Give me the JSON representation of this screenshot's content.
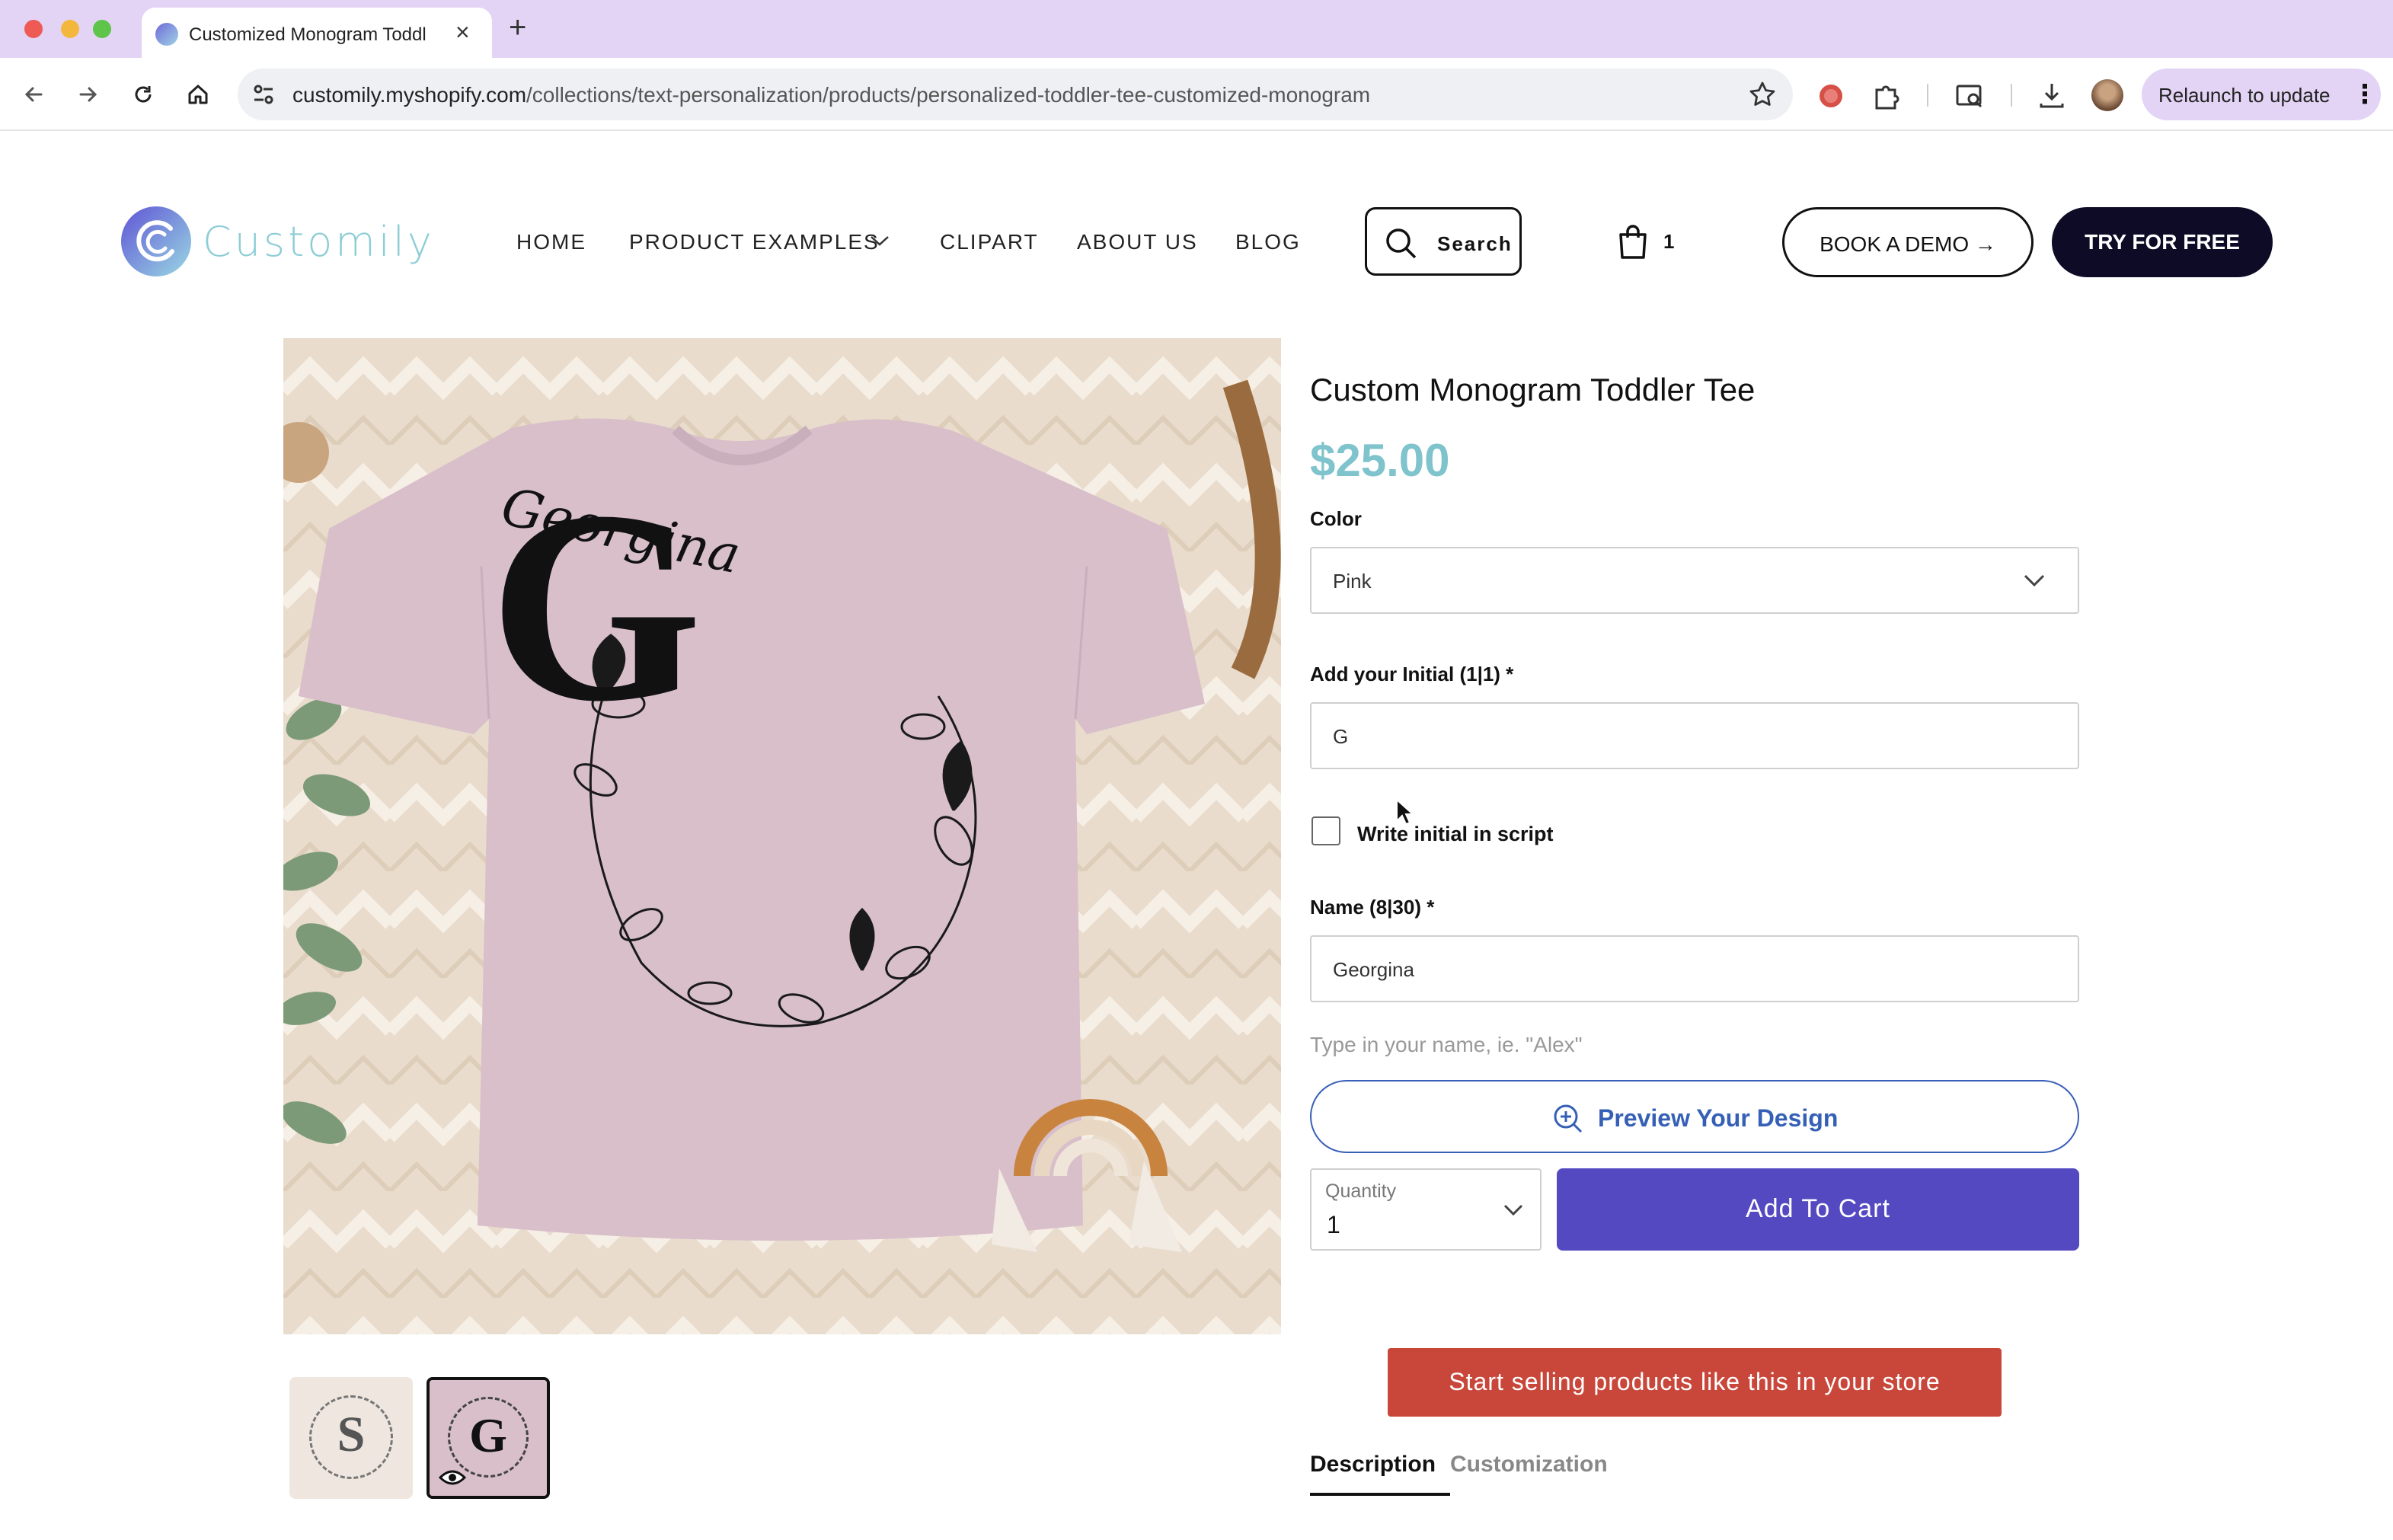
{
  "browser": {
    "tab_title": "Customized Monogram Toddl",
    "url_domain": "customily.myshopify.com",
    "url_path": "/collections/text-personalization/products/personalized-toddler-tee-customized-monogram",
    "relaunch_label": "Relaunch to update",
    "traffic_colors": [
      "#ee5b55",
      "#f4b73e",
      "#5ec54a"
    ]
  },
  "header": {
    "logo_text": "Customily",
    "nav": [
      "HOME",
      "PRODUCT EXAMPLES",
      "CLIPART",
      "ABOUT US",
      "BLOG"
    ],
    "search_label": "Search",
    "cart_count": "1",
    "demo_label": "BOOK A DEMO →",
    "try_label": "TRY FOR FREE"
  },
  "product": {
    "title": "Custom Monogram Toddler Tee",
    "price": "$25.00",
    "color_label": "Color",
    "color_value": "Pink",
    "initial_label": "Add your Initial (1|1) *",
    "initial_value": "G",
    "script_label": "Write initial in script",
    "script_checked": false,
    "name_label": "Name (8|30) *",
    "name_value": "Georgina",
    "name_hint": "Type in your name, ie. \"Alex\"",
    "preview_label": "Preview Your Design",
    "quantity_label": "Quantity",
    "quantity_value": "1",
    "add_to_cart_label": "Add To Cart",
    "sell_label": "Start selling products like this in your store",
    "tabs": [
      "Description",
      "Customization"
    ],
    "image_name_text": "Georgina",
    "image_initial": "G",
    "thumbs": [
      "S",
      "G"
    ]
  },
  "colors": {
    "brand_teal": "#7fc3cd",
    "cart_purple": "#5549c2",
    "sell_red": "#c9473a",
    "preview_blue": "#3560b6",
    "shirt_pink": "#d8bfca"
  }
}
